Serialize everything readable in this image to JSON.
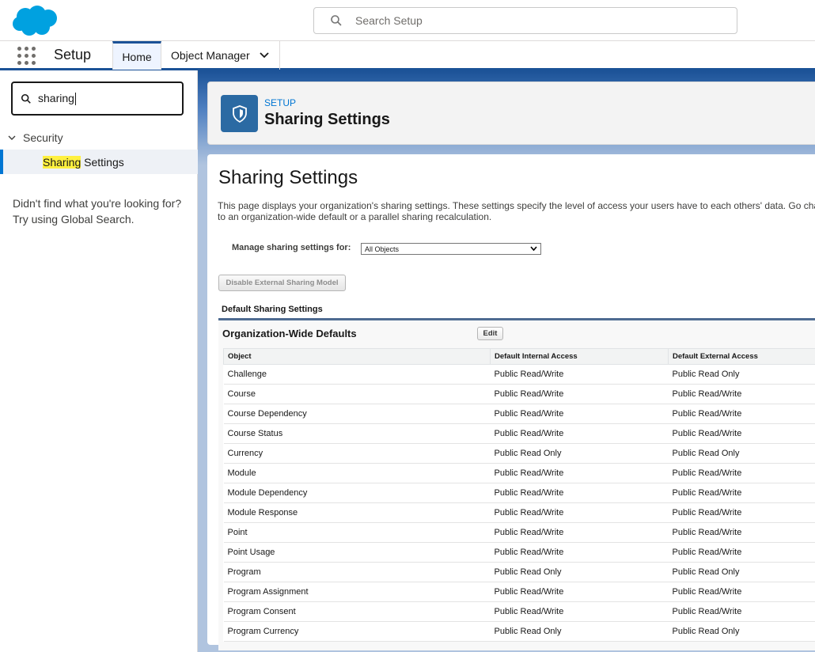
{
  "global_header": {
    "search_placeholder": "Search Setup"
  },
  "context_bar": {
    "app_name": "Setup",
    "tabs": [
      {
        "label": "Home"
      },
      {
        "label": "Object Manager"
      }
    ]
  },
  "sidebar": {
    "quick_find_value": "sharing",
    "tree": {
      "section_label": "Security",
      "item_highlight": "Sharing",
      "item_rest": " Settings"
    },
    "no_results_line1": "Didn't find what you're looking for?",
    "no_results_line2": "Try using Global Search."
  },
  "page_header": {
    "breadcrumb": "SETUP",
    "title": "Sharing Settings"
  },
  "content": {
    "title": "Sharing Settings",
    "description": "This page displays your organization's sharing settings. These settings specify the level of access your users have to each others' data. Go change to an organization-wide default or a parallel sharing recalculation.",
    "manage_label": "Manage sharing settings for:",
    "manage_select_value": "All Objects",
    "disable_button": "Disable External Sharing Model",
    "section_label": "Default Sharing Settings",
    "owd": {
      "title": "Organization-Wide Defaults",
      "edit_button": "Edit",
      "columns": [
        "Object",
        "Default Internal Access",
        "Default External Access"
      ],
      "rows": [
        [
          "Challenge",
          "Public Read/Write",
          "Public Read Only"
        ],
        [
          "Course",
          "Public Read/Write",
          "Public Read/Write"
        ],
        [
          "Course Dependency",
          "Public Read/Write",
          "Public Read/Write"
        ],
        [
          "Course Status",
          "Public Read/Write",
          "Public Read/Write"
        ],
        [
          "Currency",
          "Public Read Only",
          "Public Read Only"
        ],
        [
          "Module",
          "Public Read/Write",
          "Public Read/Write"
        ],
        [
          "Module Dependency",
          "Public Read/Write",
          "Public Read/Write"
        ],
        [
          "Module Response",
          "Public Read/Write",
          "Public Read/Write"
        ],
        [
          "Point",
          "Public Read/Write",
          "Public Read/Write"
        ],
        [
          "Point Usage",
          "Public Read/Write",
          "Public Read/Write"
        ],
        [
          "Program",
          "Public Read Only",
          "Public Read Only"
        ],
        [
          "Program Assignment",
          "Public Read/Write",
          "Public Read/Write"
        ],
        [
          "Program Consent",
          "Public Read/Write",
          "Public Read/Write"
        ],
        [
          "Program Currency",
          "Public Read Only",
          "Public Read Only"
        ]
      ]
    }
  },
  "colors": {
    "brand_blue": "#1b5297",
    "link_blue": "#0176d3",
    "cloud_blue": "#00a1e0",
    "highlight_yellow": "#fff03f"
  }
}
